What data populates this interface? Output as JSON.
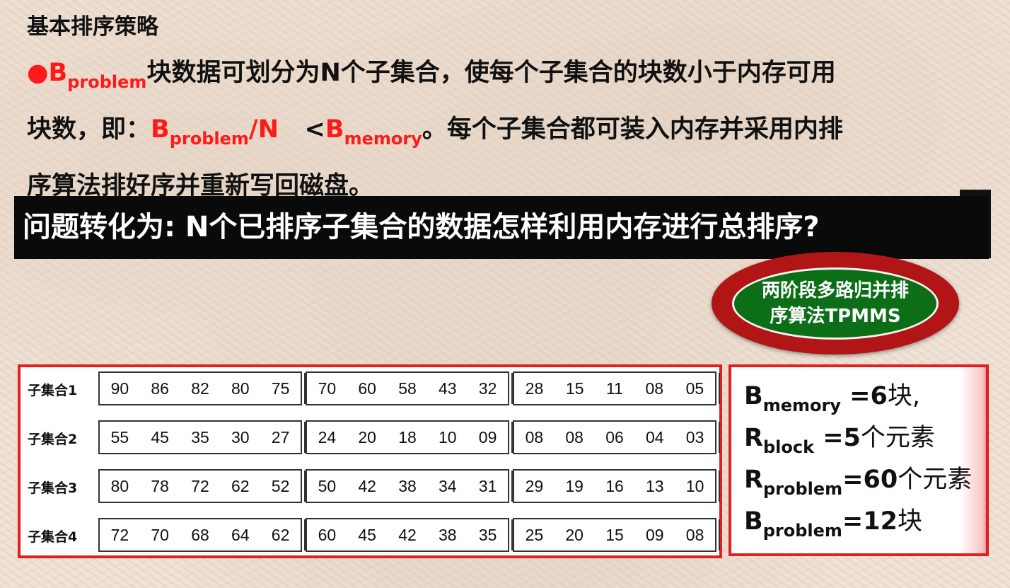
{
  "section_title": "基本排序策略",
  "paragraph": {
    "bullet": "●",
    "b_letter": "B",
    "problem_sub": "problem",
    "line1_text": "块数据可划分为N个子集合，使每个子集合的块数小于内存可用",
    "line2_prefix": "块数，即：",
    "slash_n": "/N",
    "lt": "<",
    "memory_sub": "memory",
    "line2_suffix": "。每个子集合都可装入内存并采用内排",
    "line3_text": "序算法排好序并重新写回磁盘。"
  },
  "banner": {
    "text": "问题转化为: N个已排序子集合的数据怎样利用内存进行总排序?"
  },
  "ellipse": {
    "line1": "两阶段多路归并排",
    "line2": "序算法TPMMS"
  },
  "table": {
    "rows": [
      {
        "label": "子集合1",
        "blocks": [
          [
            "90",
            "86",
            "82",
            "80",
            "75"
          ],
          [
            "70",
            "60",
            "58",
            "43",
            "32"
          ],
          [
            "28",
            "15",
            "11",
            "08",
            "05"
          ]
        ]
      },
      {
        "label": "子集合2",
        "blocks": [
          [
            "55",
            "45",
            "35",
            "30",
            "27"
          ],
          [
            "24",
            "20",
            "18",
            "10",
            "09"
          ],
          [
            "08",
            "08",
            "06",
            "04",
            "03"
          ]
        ]
      },
      {
        "label": "子集合3",
        "blocks": [
          [
            "80",
            "78",
            "72",
            "62",
            "52"
          ],
          [
            "50",
            "42",
            "38",
            "34",
            "31"
          ],
          [
            "29",
            "19",
            "16",
            "13",
            "10"
          ]
        ]
      },
      {
        "label": "子集合4",
        "blocks": [
          [
            "72",
            "70",
            "68",
            "64",
            "62"
          ],
          [
            "60",
            "45",
            "42",
            "38",
            "35"
          ],
          [
            "25",
            "20",
            "15",
            "09",
            "08"
          ]
        ]
      }
    ]
  },
  "info": {
    "l1_main": "B",
    "l1_sub": "memory",
    "l1_val": " =6",
    "l1_unit": "块,",
    "l2_main": "R",
    "l2_sub": "block",
    "l2_val": " =5",
    "l2_unit": "个元素",
    "l3_main": "R",
    "l3_sub": "problem",
    "l3_val": "=60",
    "l3_unit": "个元素",
    "l4_main": "B",
    "l4_sub": "problem",
    "l4_val": "=12",
    "l4_unit": "块"
  },
  "colors": {
    "accent_red": "#ff1a1a",
    "banner_bg": "#0a0a0a",
    "ellipse_red": "#b21515",
    "ellipse_green": "#0c6e17"
  }
}
